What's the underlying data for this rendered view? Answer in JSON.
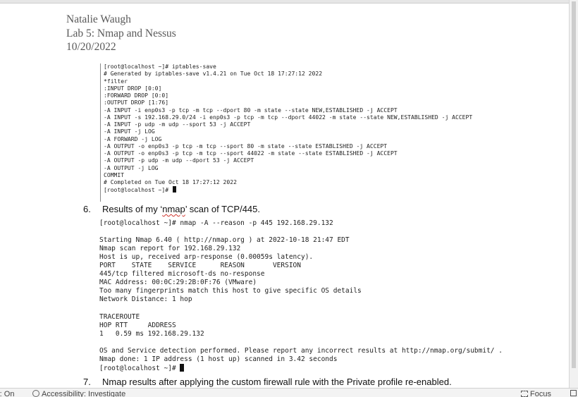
{
  "document": {
    "header": {
      "name": "Natalie Waugh",
      "title": "Lab 5: Nmap and Nessus",
      "date": "10/20/2022"
    },
    "iptables_terminal": {
      "lines": [
        "[root@localhost ~]# iptables-save",
        "# Generated by iptables-save v1.4.21 on Tue Oct 18 17:27:12 2022",
        "*filter",
        ":INPUT DROP [0:0]",
        ":FORWARD DROP [0:0]",
        ":OUTPUT DROP [1:76]",
        "-A INPUT -i enp0s3 -p tcp -m tcp --dport 80 -m state --state NEW,ESTABLISHED -j ACCEPT",
        "-A INPUT -s 192.168.29.0/24 -i enp0s3 -p tcp -m tcp --dport 44022 -m state --state NEW,ESTABLISHED -j ACCEPT",
        "-A INPUT -p udp -m udp --sport 53 -j ACCEPT",
        "-A INPUT -j LOG",
        "-A FORWARD -j LOG",
        "-A OUTPUT -o enp0s3 -p tcp -m tcp --sport 80 -m state --state ESTABLISHED -j ACCEPT",
        "-A OUTPUT -o enp0s3 -p tcp -m tcp --sport 44022 -m state --state ESTABLISHED -j ACCEPT",
        "-A OUTPUT -p udp -m udp --dport 53 -j ACCEPT",
        "-A OUTPUT -j LOG",
        "COMMIT",
        "# Completed on Tue Oct 18 17:27:12 2022"
      ],
      "prompt": "[root@localhost ~]# "
    },
    "item6": {
      "number": "6.",
      "text_before": "Results of my ‘",
      "squiggle_word": "nmap",
      "text_after": "’ scan of TCP/445."
    },
    "nmap_terminal": {
      "lines": [
        "[root@localhost ~]# nmap -A --reason -p 445 192.168.29.132",
        "",
        "Starting Nmap 6.40 ( http://nmap.org ) at 2022-10-18 21:47 EDT",
        "Nmap scan report for 192.168.29.132",
        "Host is up, received arp-response (0.00059s latency).",
        "PORT    STATE    SERVICE      REASON       VERSION",
        "445/tcp filtered microsoft-ds no-response",
        "MAC Address: 00:0C:29:2B:0F:76 (VMware)",
        "Too many fingerprints match this host to give specific OS details",
        "Network Distance: 1 hop",
        "",
        "TRACEROUTE",
        "HOP RTT     ADDRESS",
        "1   0.59 ms 192.168.29.132",
        "",
        "OS and Service detection performed. Please report any incorrect results at http://nmap.org/submit/ .",
        "Nmap done: 1 IP address (1 host up) scanned in 3.42 seconds"
      ],
      "prompt": "[root@localhost ~]# "
    },
    "item7": {
      "number": "7.",
      "text": "Nmap results after applying the custom firewall rule with the Private profile re-enabled."
    }
  },
  "statusbar": {
    "left_fragment": "r: On",
    "accessibility": "Accessibility: Investigate",
    "focus": "Focus"
  },
  "icons": {
    "accessibility": "accessibility-icon",
    "focus": "focus-icon",
    "view": "view-icon"
  }
}
